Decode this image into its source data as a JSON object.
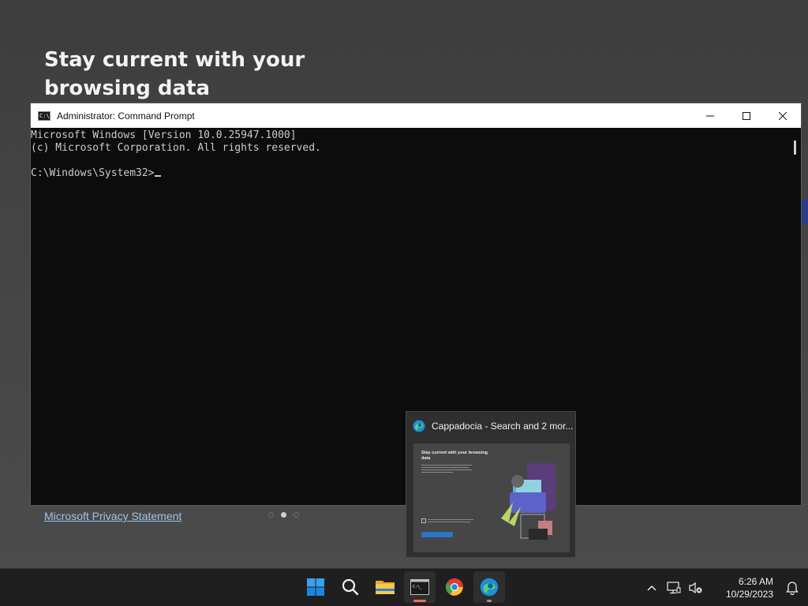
{
  "background_page": {
    "heading": "Stay current with your browsing data",
    "privacy_link": "Microsoft Privacy Statement",
    "carousel_dots": 3,
    "carousel_active": 2
  },
  "cmd_window": {
    "title": "Administrator: Command Prompt",
    "icon_label": "C:\\",
    "lines": [
      "Microsoft Windows [Version 10.0.25947.1000]",
      "(c) Microsoft Corporation. All rights reserved.",
      "",
      "C:\\Windows\\System32>"
    ],
    "controls": {
      "minimize_icon": "minimize-icon",
      "maximize_icon": "maximize-icon",
      "close_icon": "close-icon"
    }
  },
  "taskbar_preview": {
    "title": "Cappadocia - Search and 2 mor...",
    "thumbnail_heading": "Stay current with your browsing data"
  },
  "taskbar": {
    "apps": [
      {
        "name": "start",
        "icon": "windows-start-icon"
      },
      {
        "name": "search",
        "icon": "search-icon"
      },
      {
        "name": "file-explorer",
        "icon": "folder-icon"
      },
      {
        "name": "command-prompt",
        "icon": "terminal-icon",
        "active": true,
        "indicator_color": "#e8735a"
      },
      {
        "name": "chrome",
        "icon": "chrome-icon"
      },
      {
        "name": "edge",
        "icon": "edge-icon",
        "active": true,
        "indicator_color": "#9a9a9a"
      }
    ],
    "tray": {
      "time": "6:26 AM",
      "date": "10/29/2023"
    }
  },
  "colors": {
    "cmd_background": "#0c0c0c",
    "cmd_text": "#cccccc",
    "taskbar": "#1f1f1f",
    "link": "#9cc3e6"
  }
}
